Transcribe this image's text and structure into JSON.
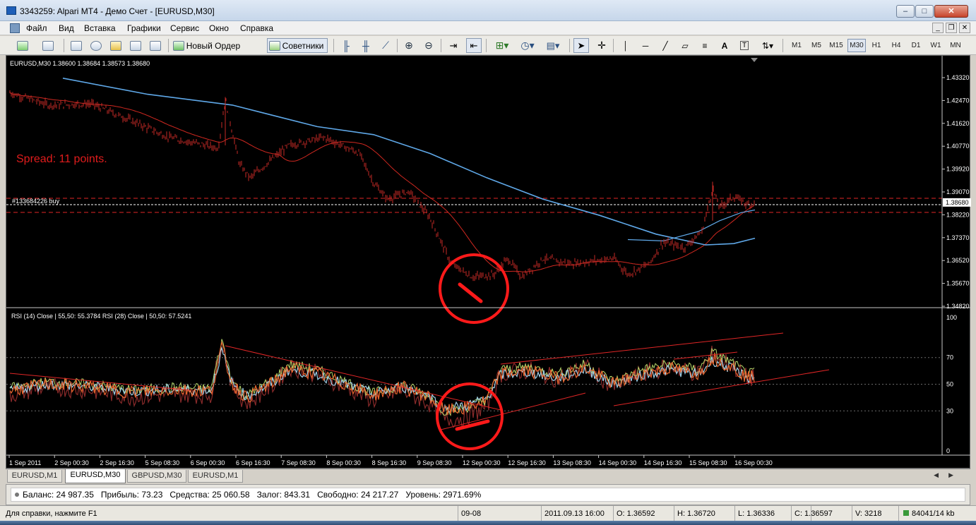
{
  "window": {
    "title": "3343259: Alpari MT4 - Демо Счет - [EURUSD,M30]",
    "buttons": {
      "minimize": "–",
      "maximize": "□",
      "close": "✕"
    }
  },
  "menu": [
    "Файл",
    "Вид",
    "Вставка",
    "Графики",
    "Сервис",
    "Окно",
    "Справка"
  ],
  "toolbar": {
    "new_order": "Новый Ордер",
    "experts": "Советники",
    "timeframes": [
      "M1",
      "M5",
      "M15",
      "M30",
      "H1",
      "H4",
      "D1",
      "W1",
      "MN"
    ],
    "active_timeframe": "M30"
  },
  "chart": {
    "header": "EURUSD,M30  1.38600 1.38684 1.38573 1.38680",
    "spread_note": "Spread: 11 points.",
    "order_label": "#133684226 buy",
    "price_axis": [
      "1.43320",
      "1.42470",
      "1.41620",
      "1.40770",
      "1.39920",
      "1.39070",
      "1.38680",
      "1.38220",
      "1.37370",
      "1.36520",
      "1.35670",
      "1.34820"
    ],
    "current_price": "1.38680",
    "rsi_header": "RSI (14) Close | 55,50: 55.3784  RSI (28) Close | 50,50: 57.5241",
    "rsi_axis": [
      "100",
      "70",
      "50",
      "30",
      "0"
    ],
    "time_axis": [
      "1 Sep 2011",
      "2 Sep 00:30",
      "2 Sep 16:30",
      "5 Sep 08:30",
      "6 Sep 00:30",
      "6 Sep 16:30",
      "7 Sep 08:30",
      "8 Sep 00:30",
      "8 Sep 16:30",
      "9 Sep 08:30",
      "12 Sep 00:30",
      "12 Sep 16:30",
      "13 Sep 08:30",
      "14 Sep 00:30",
      "14 Sep 16:30",
      "15 Sep 08:30",
      "16 Sep 00:30"
    ],
    "colors": {
      "background": "#000000",
      "bars": "#c62a26",
      "ma_fast": "#d02820",
      "ma_slow": "#5fa8e8",
      "rsi14": "#e8662e",
      "rsi28": "#9fd0e8",
      "rsi_dark": "#8a2a2a",
      "rsi_green": "#b6d86a",
      "trendline": "#e02626",
      "annotation": "#ff1a1a",
      "text": "#ffffff"
    }
  },
  "chart_tabs": [
    "EURUSD,M1",
    "EURUSD,M30",
    "GBPUSD,M30",
    "EURUSD,M1"
  ],
  "active_chart_tab": "EURUSD,M30",
  "account": {
    "balance": "Баланс: 24 987.35",
    "profit": "Прибыль: 73.23",
    "equity": "Средства: 25 060.58",
    "margin": "Залог: 843.31",
    "free": "Свободно: 24 217.27",
    "level": "Уровень: 2971.69%"
  },
  "status": {
    "help": "Для справки, нажмите F1",
    "profile": "09-08",
    "datetime": "2011.09.13 16:00",
    "open": "O: 1.36592",
    "high": "H: 1.36720",
    "low": "L: 1.36336",
    "close": "C: 1.36597",
    "volume": "V: 3218",
    "traffic": "84041/14 kb"
  }
}
